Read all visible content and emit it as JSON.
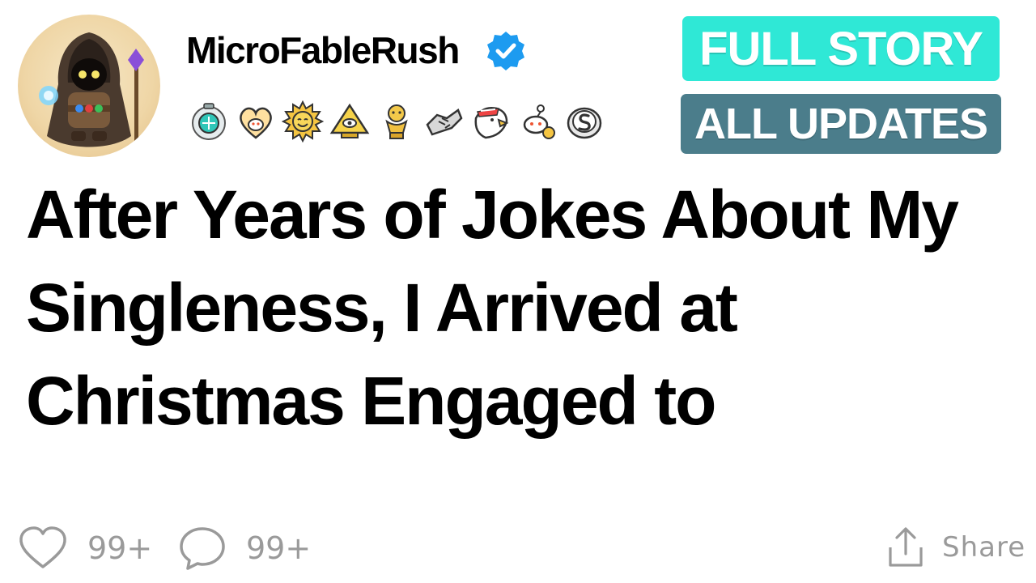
{
  "post": {
    "username": "MicroFableRush",
    "title": "After Years of Jokes About My Singleness, I Arrived at Christmas Engaged to"
  },
  "badges": {
    "full_story": "FULL STORY",
    "all_updates": "ALL UPDATES"
  },
  "awards": [
    "gem-award-icon",
    "heart-snoo-award-icon",
    "sun-award-icon",
    "illuminati-award-icon",
    "trophy-snoo-award-icon",
    "handshake-award-icon",
    "eagle-award-icon",
    "snoo-award-icon",
    "silver-award-icon"
  ],
  "actions": {
    "likes": "99+",
    "comments": "99+",
    "share_label": "Share"
  },
  "colors": {
    "full_story_bg": "#2fe8d6",
    "all_updates_bg": "#4b7d8b",
    "verified": "#1d9bf0",
    "action_gray": "#9a9a9a"
  }
}
